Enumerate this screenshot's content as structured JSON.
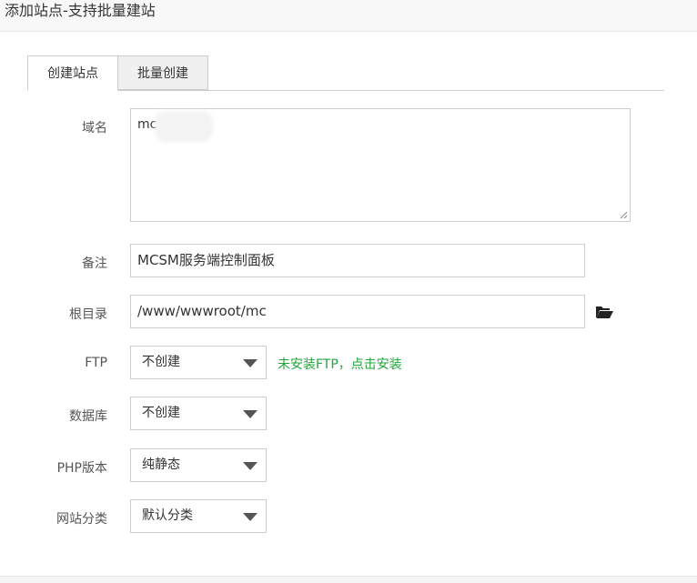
{
  "dialog": {
    "title": "添加站点-支持批量建站"
  },
  "tabs": [
    {
      "label": "创建站点",
      "active": true
    },
    {
      "label": "批量创建",
      "active": false
    }
  ],
  "form": {
    "domain": {
      "label": "域名",
      "value": "mc"
    },
    "remark": {
      "label": "备注",
      "value": "MCSM服务端控制面板"
    },
    "root": {
      "label": "根目录",
      "value": "/www/wwwroot/mc",
      "icon": "folder-open-icon"
    },
    "ftp": {
      "label": "FTP",
      "selected": "不创建",
      "hint": "未安装FTP，点击安装",
      "hint_color": "#20a53a"
    },
    "database": {
      "label": "数据库",
      "selected": "不创建"
    },
    "php": {
      "label": "PHP版本",
      "selected": "纯静态"
    },
    "category": {
      "label": "网站分类",
      "selected": "默认分类"
    }
  }
}
